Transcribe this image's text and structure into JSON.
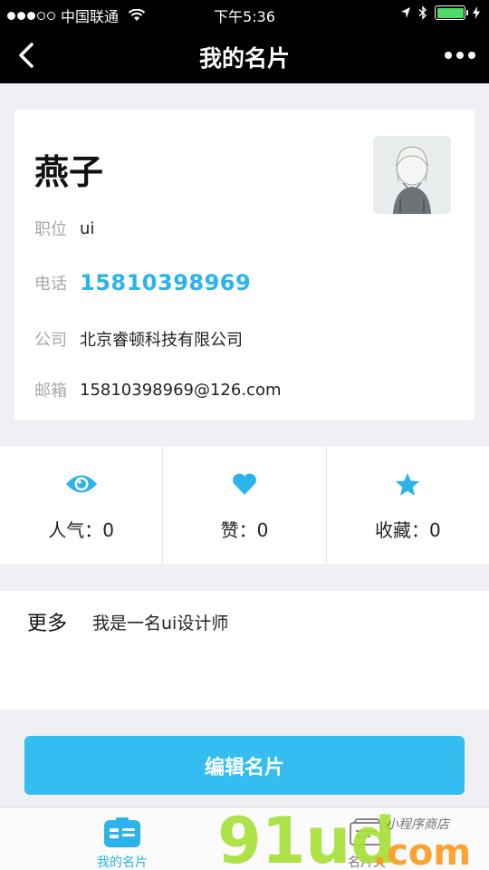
{
  "status_bar": {
    "carrier": "中国联通",
    "time": "下午5:36"
  },
  "nav": {
    "title": "我的名片",
    "back_icon": "chevron-left-icon",
    "more_icon": "more-dots-icon"
  },
  "card": {
    "name": "燕子",
    "avatar": "avatar-illustration",
    "rows": [
      {
        "label": "职位",
        "value": "ui"
      },
      {
        "label": "电话",
        "value": "15810398969"
      },
      {
        "label": "公司",
        "value": "北京睿顿科技有限公司"
      },
      {
        "label": "邮箱",
        "value": "15810398969@126.com"
      }
    ]
  },
  "stats": [
    {
      "icon": "eye-icon",
      "text": "人气：0"
    },
    {
      "icon": "heart-icon",
      "text": "赞：0"
    },
    {
      "icon": "star-icon",
      "text": "收藏：0"
    }
  ],
  "more": {
    "label": "更多",
    "text": "我是一名ui设计师"
  },
  "edit_button": {
    "label": "编辑名片"
  },
  "tabs": [
    {
      "label": "我的名片",
      "icon": "card-icon",
      "active": true
    },
    {
      "label": "名片夹",
      "icon": "card-holder-icon",
      "active": false
    }
  ],
  "watermark": {
    "brand": "91ud.com",
    "tagline": "小程序商店"
  },
  "colors": {
    "accent": "#33bdf1",
    "phone": "#2bb3ea",
    "nav_bg": "#000000",
    "page_bg": "#efeff4",
    "battery": "#4cd964"
  }
}
